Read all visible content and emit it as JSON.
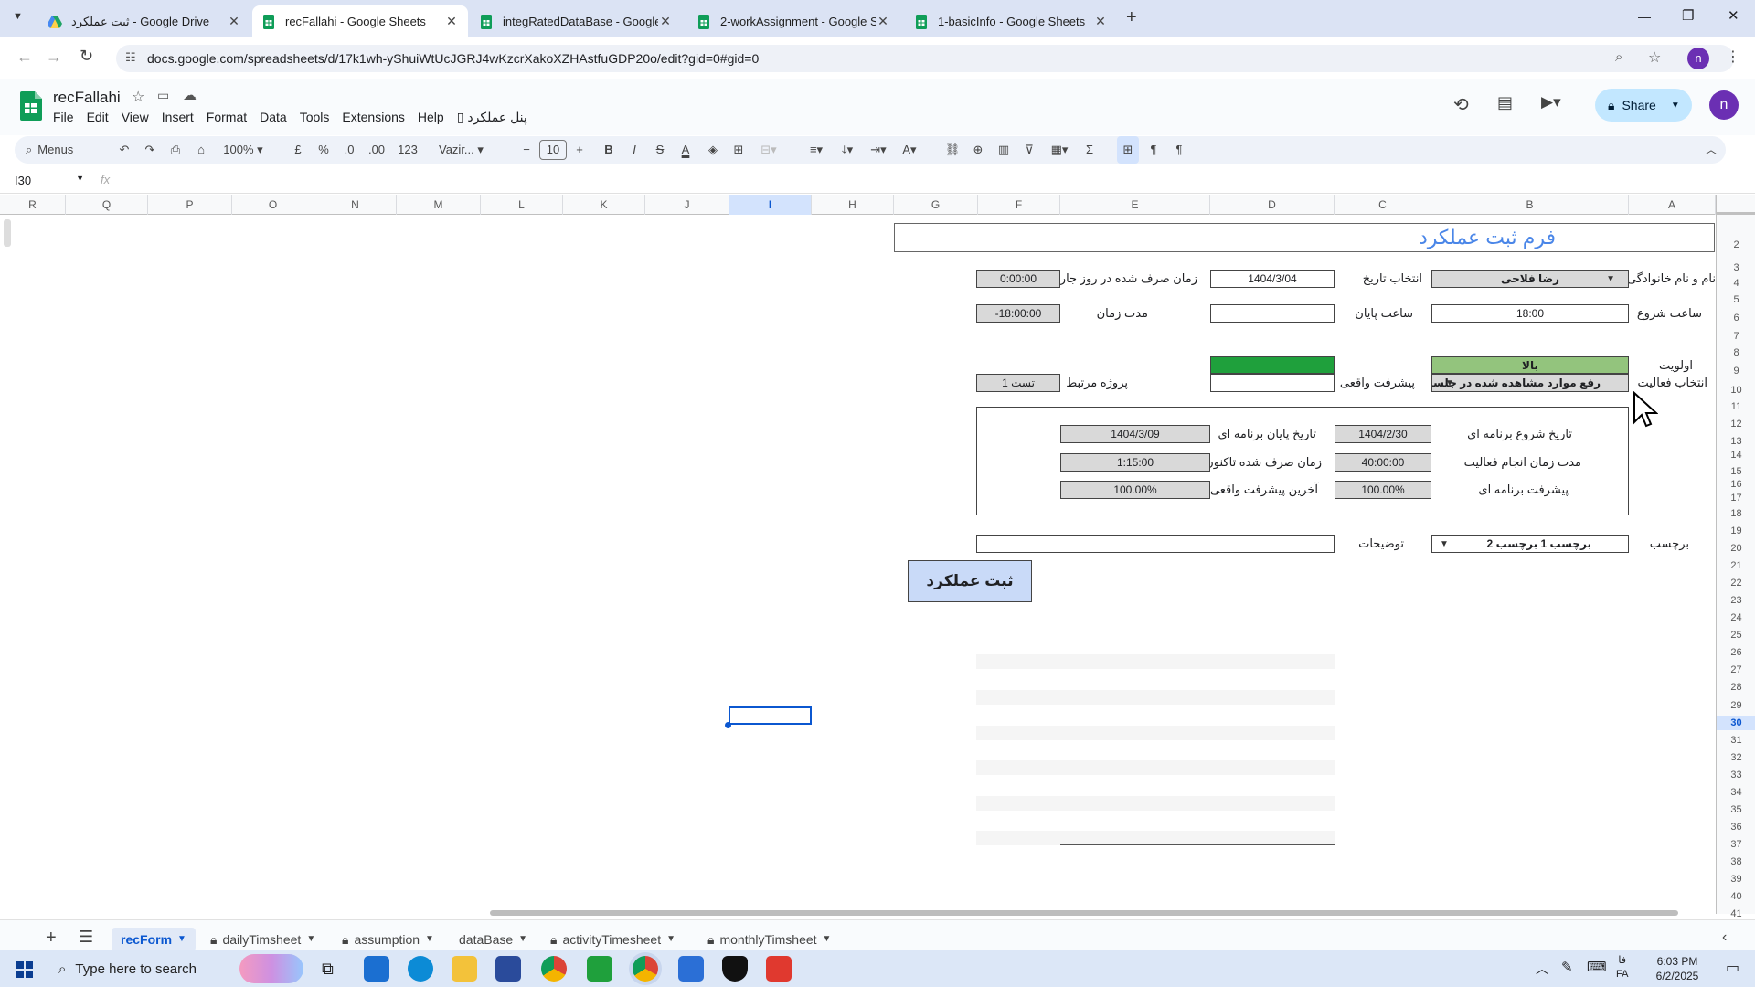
{
  "browser": {
    "tabs": [
      {
        "title": "ثبت عملکرد - Google Drive",
        "active": false,
        "icon": "drive-icon"
      },
      {
        "title": "recFallahi - Google Sheets",
        "active": true,
        "icon": "sheets-icon"
      },
      {
        "title": "integRatedDataBase - Google S",
        "active": false,
        "icon": "sheets-icon"
      },
      {
        "title": "2-workAssignment - Google Sh",
        "active": false,
        "icon": "sheets-icon"
      },
      {
        "title": "1-basicInfo - Google Sheets",
        "active": false,
        "icon": "sheets-icon"
      }
    ],
    "url": "docs.google.com/spreadsheets/d/17k1wh-yShuiWtUcJGRJ4wKzcrXakoXZHAstfuGDP20o/edit?gid=0#gid=0",
    "profile_initial": "n"
  },
  "app": {
    "doc_title": "recFallahi",
    "menus": [
      "File",
      "Edit",
      "View",
      "Insert",
      "Format",
      "Data",
      "Tools",
      "Extensions",
      "Help"
    ],
    "extra_menu": "پنل عملکرد",
    "share_label": "Share",
    "account_initial": "n"
  },
  "toolbar": {
    "menus_label": "Menus",
    "zoom": "100%",
    "currency": "£",
    "percent": "%",
    "dec_decrease": ".0",
    "dec_increase": ".00",
    "number_format": "123",
    "font": "Vazir...",
    "font_size": "10"
  },
  "formula_bar": {
    "cell_ref": "I30"
  },
  "columns": [
    "R",
    "Q",
    "P",
    "O",
    "N",
    "M",
    "L",
    "K",
    "J",
    "I",
    "H",
    "G",
    "F",
    "E",
    "D",
    "C",
    "B",
    "A"
  ],
  "selected_column": "I",
  "rows": [
    "2",
    "3",
    "4",
    "5",
    "6",
    "7",
    "8",
    "9",
    "10",
    "11",
    "12",
    "13",
    "14",
    "15",
    "16",
    "17",
    "18",
    "19",
    "20",
    "21",
    "22",
    "23",
    "24",
    "25",
    "26",
    "27",
    "28",
    "29",
    "30",
    "31",
    "32",
    "33",
    "34",
    "35",
    "36",
    "37",
    "38",
    "39",
    "40",
    "41"
  ],
  "selected_row": "30",
  "form": {
    "title": "فرم ثبت عملکرد",
    "fields": {
      "name_label": "نام و نام خانوادگی",
      "name_value": "رضا فلاحی",
      "date_label": "انتخاب تاریخ",
      "date_value": "1404/3/04",
      "time_spent_today_label": "زمان صرف شده در روز جاری",
      "time_spent_today_value": "0:00:00",
      "start_time_label": "ساعت شروع",
      "start_time_value": "18:00",
      "end_time_label": "ساعت پایان",
      "end_time_value": "",
      "duration_label": "مدت زمان",
      "duration_value": "-18:00:00",
      "priority_label": "اولویت",
      "priority_value": "بالا",
      "activity_label": "انتخاب فعالیت",
      "activity_value": "رفع موارد مشاهده شده در جلسات...",
      "actual_progress_label": "پیشرفت واقعی",
      "actual_progress_value": "",
      "related_project_label": "پروژه مرتبط",
      "related_project_value": "تست 1"
    },
    "summary": {
      "planned_start_label": "تاریخ شروع برنامه ای",
      "planned_start_value": "1404/2/30",
      "planned_end_label": "تاریخ پایان برنامه ای",
      "planned_end_value": "1404/3/09",
      "activity_duration_label": "مدت زمان انجام فعالیت",
      "activity_duration_value": "40:00:00",
      "time_spent_so_far_label": "زمان صرف شده تاکنون",
      "time_spent_so_far_value": "1:15:00",
      "planned_progress_label": "پیشرفت برنامه ای",
      "planned_progress_value": "100.00%",
      "last_actual_progress_label": "آخرین پیشرفت واقعی",
      "last_actual_progress_value": "100.00%"
    },
    "tag_label": "برچسب",
    "tag_values": "برچسب 1   برچسب 2",
    "description_label": "توضیحات",
    "description_value": "",
    "submit_label": "ثبت عملکرد"
  },
  "sheet_tabs": [
    {
      "name": "recForm",
      "active": true,
      "locked": false
    },
    {
      "name": "dailyTimsheet",
      "active": false,
      "locked": true
    },
    {
      "name": "assumption",
      "active": false,
      "locked": true
    },
    {
      "name": "dataBase",
      "active": false,
      "locked": false
    },
    {
      "name": "activityTimesheet",
      "active": false,
      "locked": true
    },
    {
      "name": "monthlyTimsheet",
      "active": false,
      "locked": true
    }
  ],
  "taskbar": {
    "search_placeholder": "Type here to search",
    "time": "6:03 PM",
    "date": "6/2/2025",
    "lang1": "فا",
    "lang2": "FA"
  },
  "colors": {
    "accent": "#0b57d0",
    "green": "#1fa03c",
    "light_green": "#93c47d",
    "form_title": "#4a86e8",
    "submit_bg": "#c9daf8"
  }
}
